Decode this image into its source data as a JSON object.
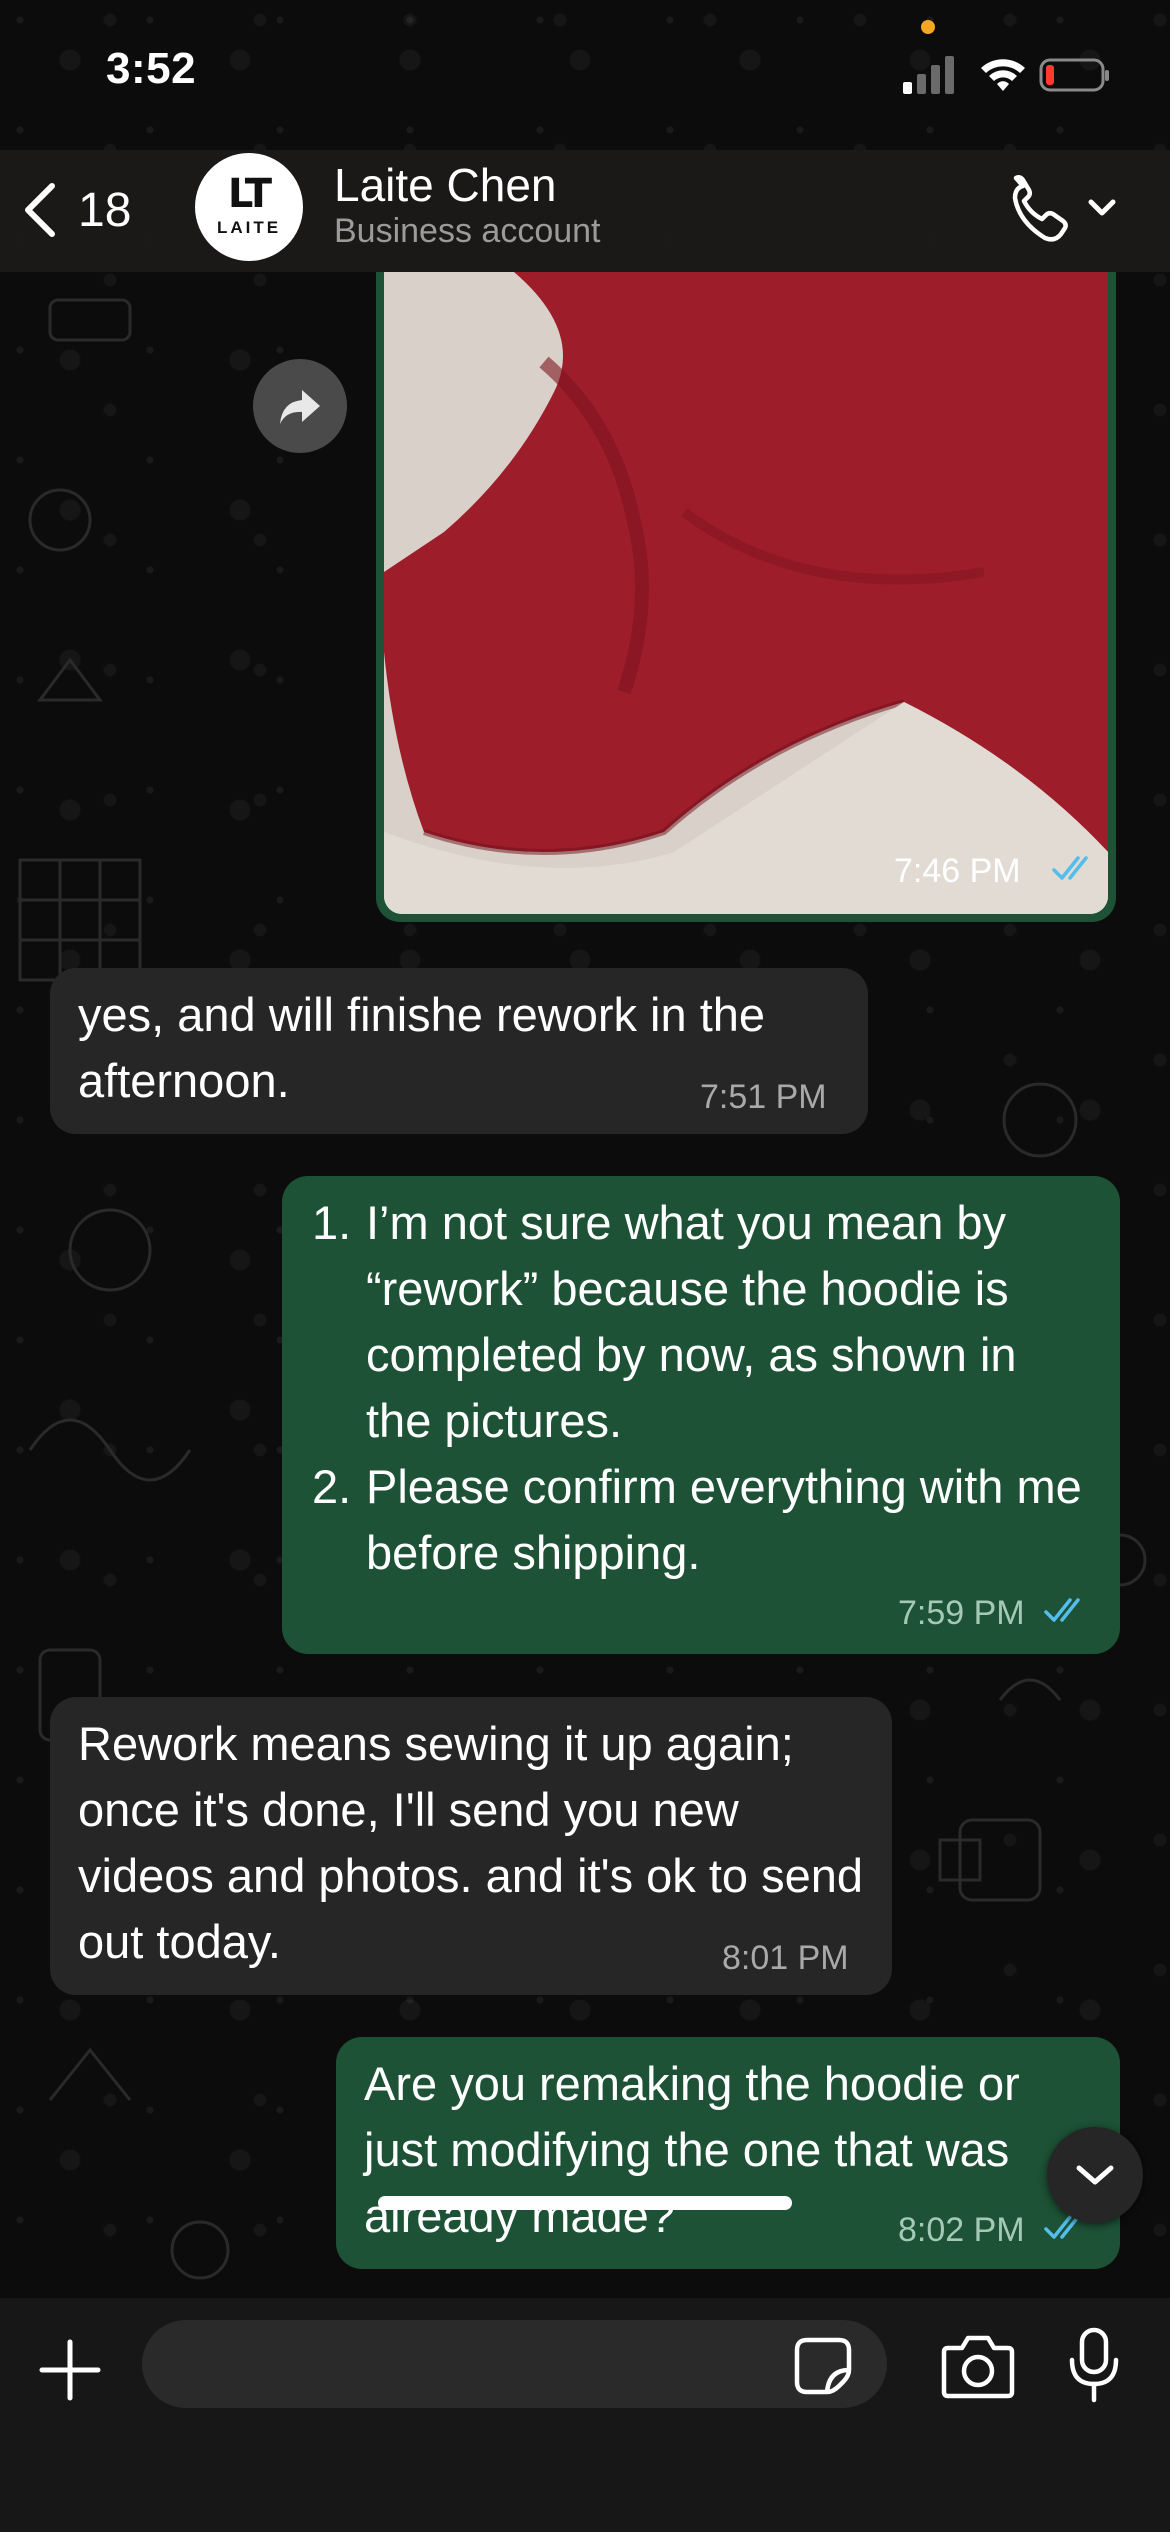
{
  "status_bar": {
    "time": "3:52"
  },
  "header": {
    "back_count": "18",
    "avatar_mark": "LT",
    "avatar_text": "LAITE",
    "contact_name": "Laite Chen",
    "contact_subtitle": "Business account"
  },
  "messages": [
    {
      "direction": "out",
      "type": "image",
      "time": "7:46 PM",
      "status": "read"
    },
    {
      "direction": "in",
      "text": "yes, and will finishe rework in the afternoon.",
      "time": "7:51 PM"
    },
    {
      "direction": "out",
      "type": "list",
      "items": [
        {
          "num": "1.",
          "text": "I’m not sure what you mean by “rework” because the hoodie is completed by now, as shown in the pictures."
        },
        {
          "num": "2.",
          "text": "Please confirm everything with me before shipping."
        }
      ],
      "time": "7:59 PM",
      "status": "read"
    },
    {
      "direction": "in",
      "text": "Rework means sewing it up again; once it's done, I'll send you new videos and photos. and it's ok to send out today.",
      "time": "8:01 PM"
    },
    {
      "direction": "out",
      "text": "Are you remaking the hoodie or just modifying the one that was already made?",
      "time": "8:02 PM",
      "status": "read"
    }
  ],
  "composer": {
    "placeholder": ""
  },
  "colors": {
    "incoming_bubble": "#262626",
    "outgoing_bubble": "#1d5236",
    "read_ticks": "#53bdeb",
    "hoodie_red": "#a51f2c"
  },
  "icons": [
    "chevron-left-icon",
    "phone-icon",
    "chevron-down-icon",
    "forward-icon",
    "plus-icon",
    "sticker-icon",
    "camera-icon",
    "mic-icon",
    "signal-icon",
    "wifi-icon",
    "battery-icon"
  ]
}
